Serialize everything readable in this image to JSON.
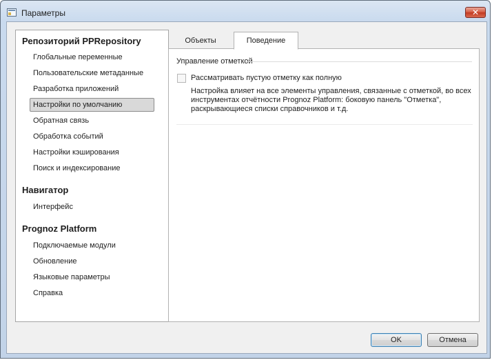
{
  "window": {
    "title": "Параметры",
    "close_glyph": "✕"
  },
  "nav": {
    "groups": [
      {
        "title": "Репозиторий PPRepository",
        "items": [
          "Глобальные переменные",
          "Пользовательские метаданные",
          "Разработка приложений",
          "Настройки по умолчанию",
          "Обратная связь",
          "Обработка событий",
          "Настройки кэширования",
          "Поиск и индексирование"
        ]
      },
      {
        "title": "Навигатор",
        "items": [
          "Интерфейс"
        ]
      },
      {
        "title": "Prognoz Platform",
        "items": [
          "Подключаемые модули",
          "Обновление",
          "Языковые параметры",
          "Справка"
        ]
      }
    ],
    "selected": "Настройки по умолчанию"
  },
  "tabs": {
    "objects": "Объекты",
    "behavior": "Поведение",
    "active": "Поведение"
  },
  "behavior": {
    "group_title": "Управление отметкой",
    "checkbox_label": "Рассматривать пустую отметку как полную",
    "checkbox_checked": false,
    "description": "Настройка влияет на все элементы управления, связанные с отметкой, во всех инструментах отчётности Prognoz Platform: боковую панель \"Отметка\", раскрывающиеся списки справочников и т.д."
  },
  "buttons": {
    "ok": "OK",
    "cancel": "Отмена"
  },
  "colors": {
    "frame": "#c2d3e8",
    "client_bg": "#f0f0f0",
    "selected_item_bg": "#d9d9d9",
    "close_button": "#c23a22",
    "default_button_border": "#3c7fb1"
  }
}
